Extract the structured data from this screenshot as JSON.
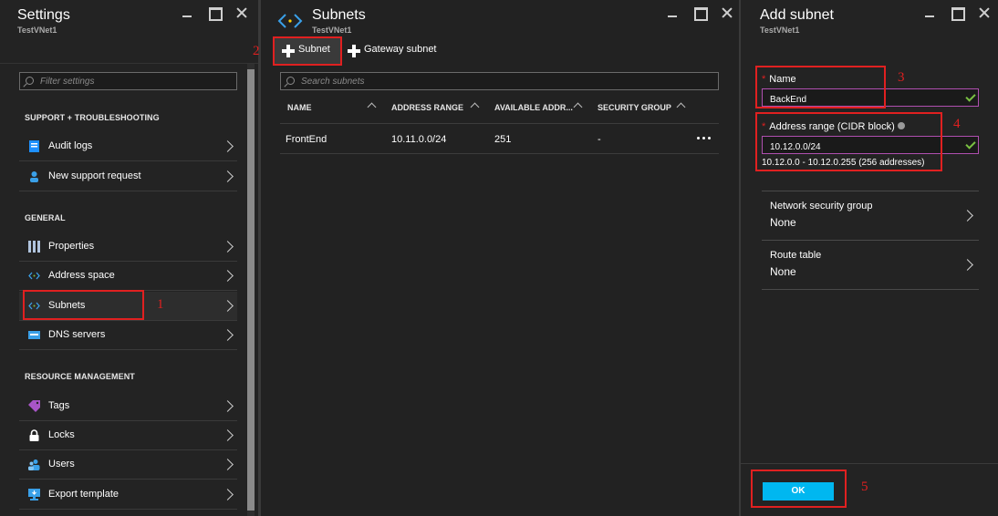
{
  "settings_blade": {
    "title": "Settings",
    "subtitle": "TestVNet1",
    "filter_placeholder": "Filter settings",
    "sections": [
      {
        "heading": "SUPPORT + TROUBLESHOOTING",
        "items": [
          {
            "label": "Audit logs",
            "icon": "audit-log-icon"
          },
          {
            "label": "New support request",
            "icon": "support-person-icon"
          }
        ]
      },
      {
        "heading": "GENERAL",
        "items": [
          {
            "label": "Properties",
            "icon": "properties-bars-icon"
          },
          {
            "label": "Address space",
            "icon": "address-space-icon"
          },
          {
            "label": "Subnets",
            "icon": "subnets-icon"
          },
          {
            "label": "DNS servers",
            "icon": "dns-servers-icon"
          }
        ]
      },
      {
        "heading": "RESOURCE MANAGEMENT",
        "items": [
          {
            "label": "Tags",
            "icon": "tag-icon"
          },
          {
            "label": "Locks",
            "icon": "lock-icon"
          },
          {
            "label": "Users",
            "icon": "users-icon"
          },
          {
            "label": "Export template",
            "icon": "export-template-icon"
          }
        ]
      }
    ]
  },
  "subnets_blade": {
    "title": "Subnets",
    "subtitle": "TestVNet1",
    "toolbar": {
      "add_subnet": "Subnet",
      "add_gateway": "Gateway subnet"
    },
    "search_placeholder": "Search subnets",
    "columns": [
      "NAME",
      "ADDRESS RANGE",
      "AVAILABLE ADDR...",
      "SECURITY GROUP"
    ],
    "rows": [
      {
        "name": "FrontEnd",
        "address_range": "10.11.0.0/24",
        "available": "251",
        "security_group": "-"
      }
    ]
  },
  "add_subnet_blade": {
    "title": "Add subnet",
    "subtitle": "TestVNet1",
    "name_label": "Name",
    "name_value": "BackEnd",
    "range_label": "Address range (CIDR block)",
    "range_value": "10.12.0.0/24",
    "range_hint": "10.12.0.0 - 10.12.0.255 (256 addresses)",
    "nsg_label": "Network security group",
    "nsg_value": "None",
    "route_label": "Route table",
    "route_value": "None",
    "ok_label": "OK"
  },
  "callouts": [
    "1",
    "2",
    "3",
    "4",
    "5"
  ],
  "colors": {
    "accent": "#00b7f0",
    "callout": "#e02020",
    "valid": "#7ac142",
    "field_border": "#b04fb0"
  }
}
